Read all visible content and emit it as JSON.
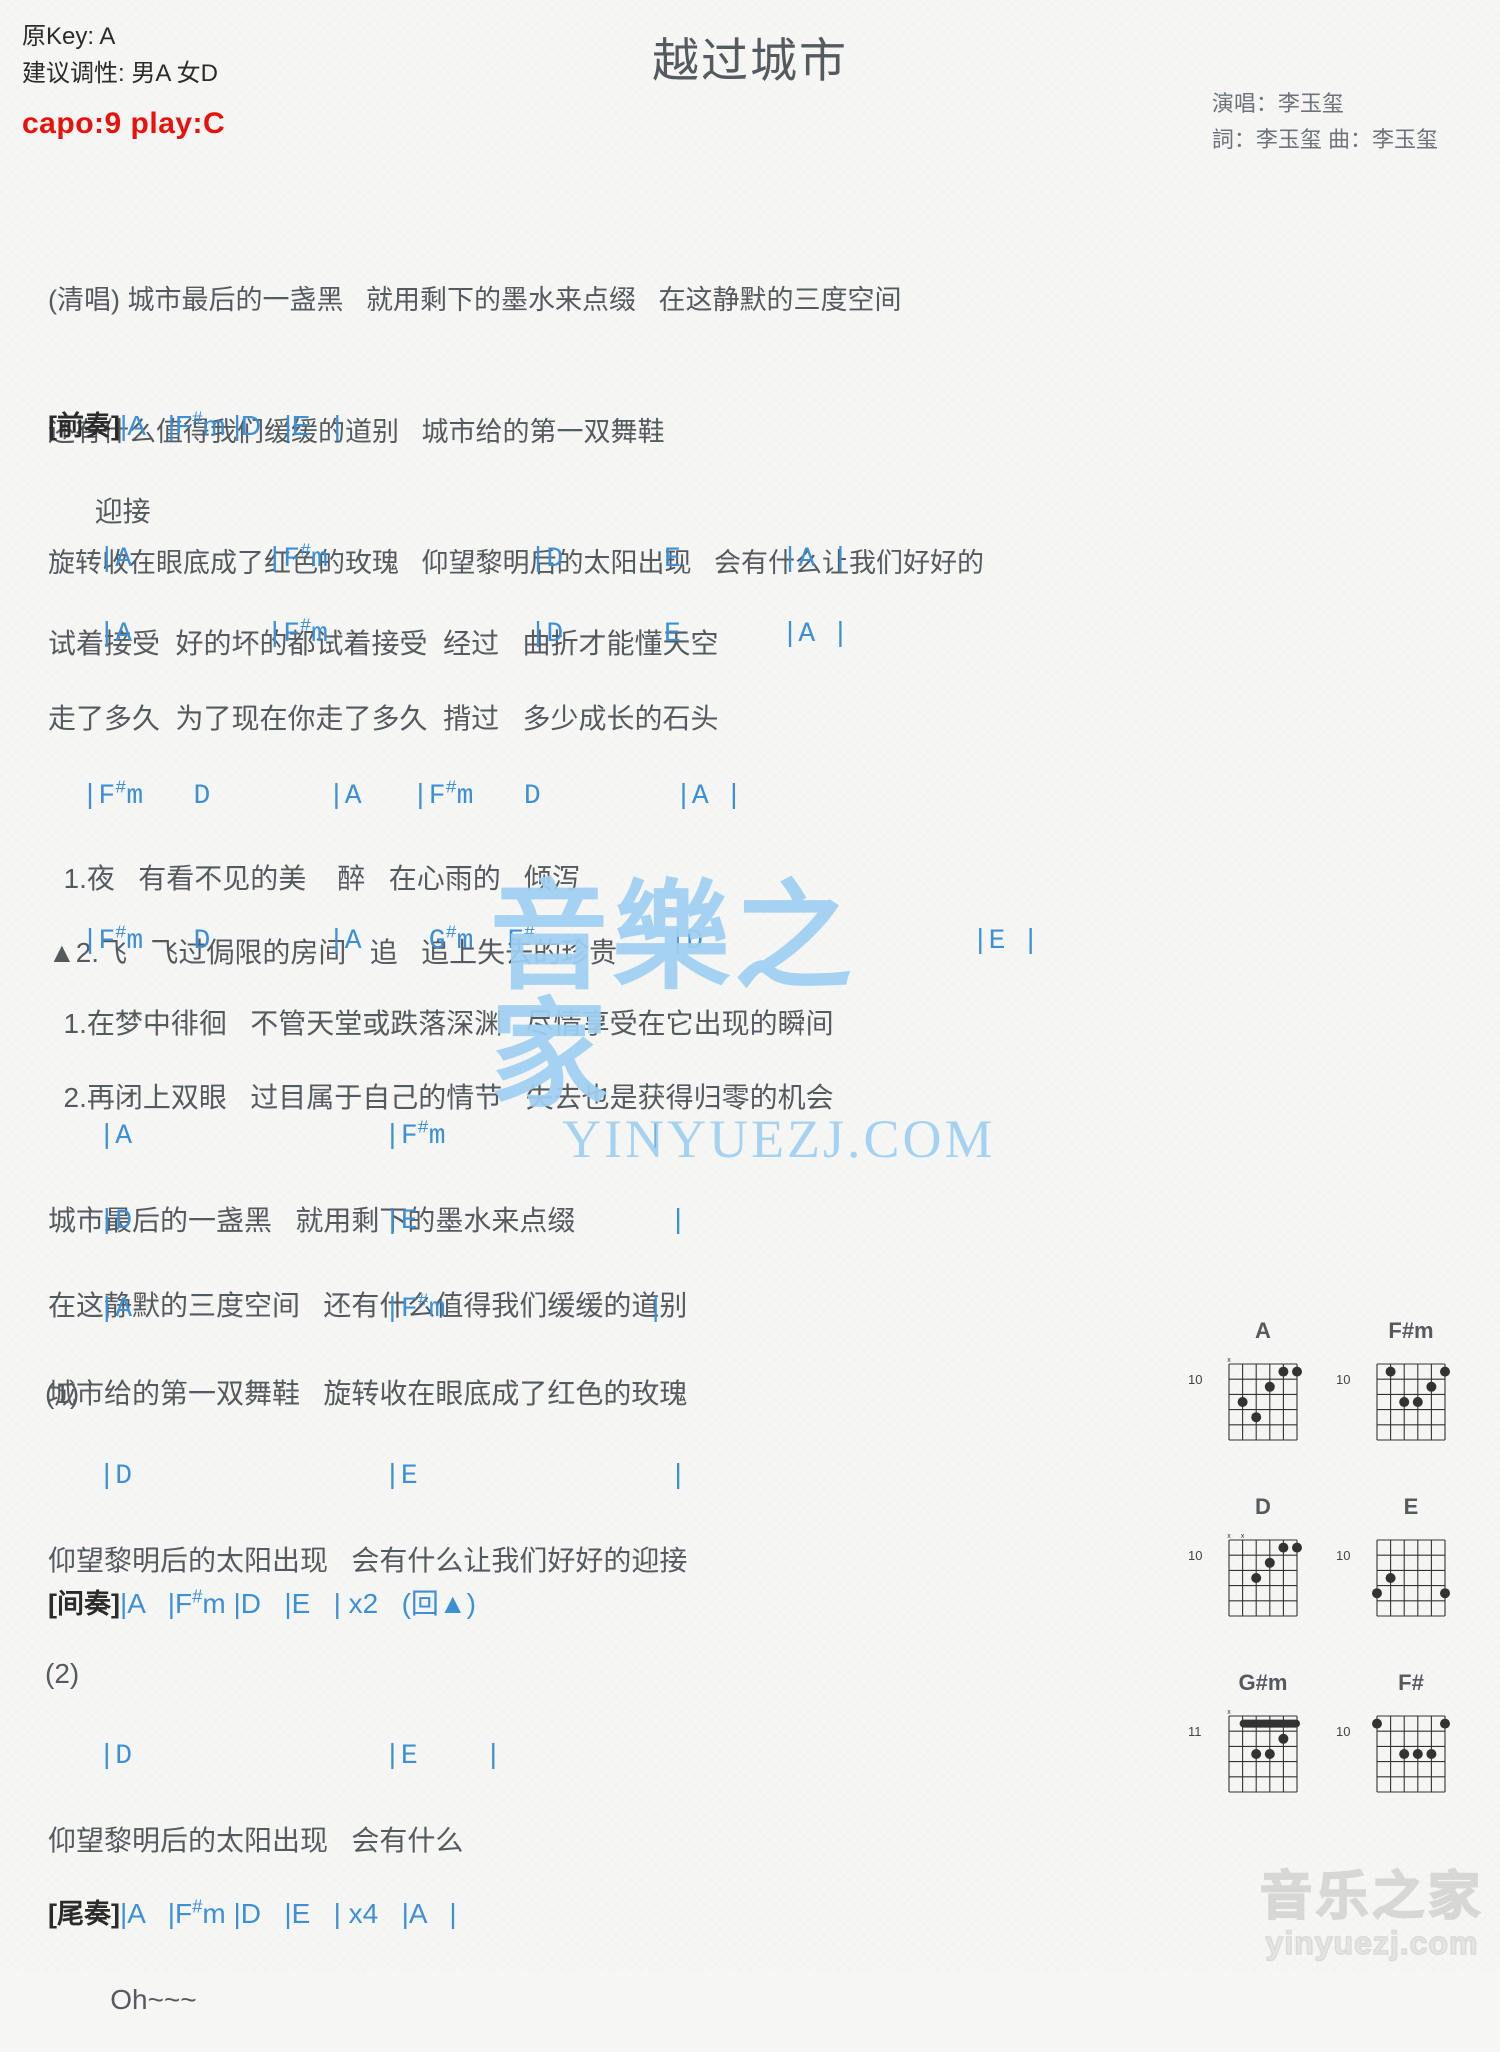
{
  "header": {
    "orig_key_label": "原Key: A",
    "suggest_key_label": "建议调性: 男A 女D",
    "capo": "capo:9 play:C",
    "title": "越过城市",
    "singer": "演唱：李玉玺",
    "writer": "詞：李玉玺  曲：李玉玺"
  },
  "intro_lyrics": [
    "(清唱) 城市最后的一盏黑   就用剩下的墨水来点缀   在这静默的三度空间",
    "还有什么值得我们缓缓的道别   城市给的第一双舞鞋",
    "旋转收在眼底成了红色的玫瑰   仰望黎明后的太阳出现   会有什么让我们好好的"
  ],
  "sections": [
    {
      "name": "prelude",
      "tag": "[前奏]",
      "chord_line": "|A   |F#m |D   |E   |",
      "lyric_line": "      迎接"
    },
    {
      "name": "verse1-line1",
      "chord_line": "   |A        |F#m            |D      E      |A |",
      "lyric_line": "试着接受  好的坏的都试着接受  经过   曲折才能懂天空"
    },
    {
      "name": "verse1-line2",
      "chord_line": "   |A        |F#m            |D      E      |A |",
      "lyric_line": "走了多久  为了现在你走了多久  揹过   多少成长的石头"
    },
    {
      "name": "chorus1-chords",
      "chord_line": "  |F#m   D       |A   |F#m   D        |A |",
      "lyric_line_1": "  1.夜   有看不见的美    醉   在心雨的   倾泻",
      "lyric_line_2": "▲2.飞   飞过侷限的房间   追   追上失去的珍贵"
    },
    {
      "name": "chorus2-chords",
      "chord_line": "  |F#m   D       |A    G#m  F#  -     |D                |E |",
      "lyric_line_1": "  1.在梦中徘徊   不管天堂或跌落深渊   尽情享受在它出现的瞬间",
      "lyric_line_2": "  2.再闭上双眼   过目属于自己的情节   失去也是获得归零的机会"
    },
    {
      "name": "bridge-line1",
      "chord_line": "   |A               |F#m            |",
      "lyric_line": "城市最后的一盏黑   就用剩下的墨水来点缀"
    },
    {
      "name": "bridge-line2",
      "chord_line": "   |D               |E               |",
      "lyric_line": "在这静默的三度空间   还有什么值得我们缓缓的道别"
    },
    {
      "name": "bridge-line3",
      "chord_line": "   |A               |F#m            |",
      "lyric_line": "城市给的第一双舞鞋   旋转收在眼底成了红色的玫瑰"
    },
    {
      "name": "ending1-marker",
      "marker": "(1)"
    },
    {
      "name": "ending1-line",
      "chord_line": "   |D               |E               |",
      "lyric_line": "仰望黎明后的太阳出现   会有什么让我们好好的迎接"
    },
    {
      "name": "interlude",
      "tag": "[间奏]",
      "chord_line": "|A   |F#m |D   |E   | x2   (回▲)"
    },
    {
      "name": "ending2-marker",
      "marker": "(2)"
    },
    {
      "name": "ending2-line",
      "chord_line": "   |D               |E    |",
      "lyric_line": "仰望黎明后的太阳出现   会有什么"
    },
    {
      "name": "outro",
      "tag": "[尾奏]",
      "chord_line": "|A   |F#m |D   |E   | x4   |A   |",
      "lyric_line": "        Oh~~~"
    }
  ],
  "chord_diagrams": [
    {
      "name": "A",
      "start_fret": "10",
      "muted": [
        6
      ],
      "barre": null,
      "dots": [
        [
          5,
          3
        ],
        [
          4,
          4
        ],
        [
          3,
          2
        ],
        [
          2,
          1
        ],
        [
          1,
          1
        ]
      ]
    },
    {
      "name": "F#m",
      "start_fret": "10",
      "muted": [],
      "barre": null,
      "dots": [
        [
          5,
          1
        ],
        [
          4,
          3
        ],
        [
          3,
          3
        ],
        [
          2,
          2
        ],
        [
          1,
          1
        ]
      ]
    },
    {
      "name": "D",
      "start_fret": "10",
      "muted": [
        6,
        5
      ],
      "barre": null,
      "dots": [
        [
          4,
          3
        ],
        [
          3,
          2
        ],
        [
          2,
          1
        ],
        [
          1,
          1
        ]
      ]
    },
    {
      "name": "E",
      "start_fret": "10",
      "muted": [],
      "barre": null,
      "dots": [
        [
          6,
          4
        ],
        [
          5,
          3
        ],
        [
          1,
          4
        ]
      ]
    },
    {
      "name": "G#m",
      "start_fret": "11",
      "muted": [
        6
      ],
      "barre": {
        "fret": 1,
        "from": 5,
        "to": 1
      },
      "dots": [
        [
          4,
          3
        ],
        [
          3,
          3
        ],
        [
          2,
          2
        ]
      ]
    },
    {
      "name": "F#",
      "start_fret": "10",
      "muted": [],
      "barre": null,
      "dots": [
        [
          6,
          1
        ],
        [
          4,
          3
        ],
        [
          3,
          3
        ],
        [
          2,
          3
        ],
        [
          1,
          1
        ]
      ]
    }
  ],
  "watermark": {
    "center_cn": "音樂之家",
    "center_en": "YINYUEZJ.COM",
    "logo_cn": "音乐之家",
    "logo_en": "yinyuezj.com"
  },
  "colors": {
    "chord": "#3d8fd6",
    "lyric": "#555a5e",
    "capo": "#e8110c",
    "tag": "#2b2b2b",
    "watermark": "#9fd0f2",
    "background": "#f6f6f4"
  }
}
